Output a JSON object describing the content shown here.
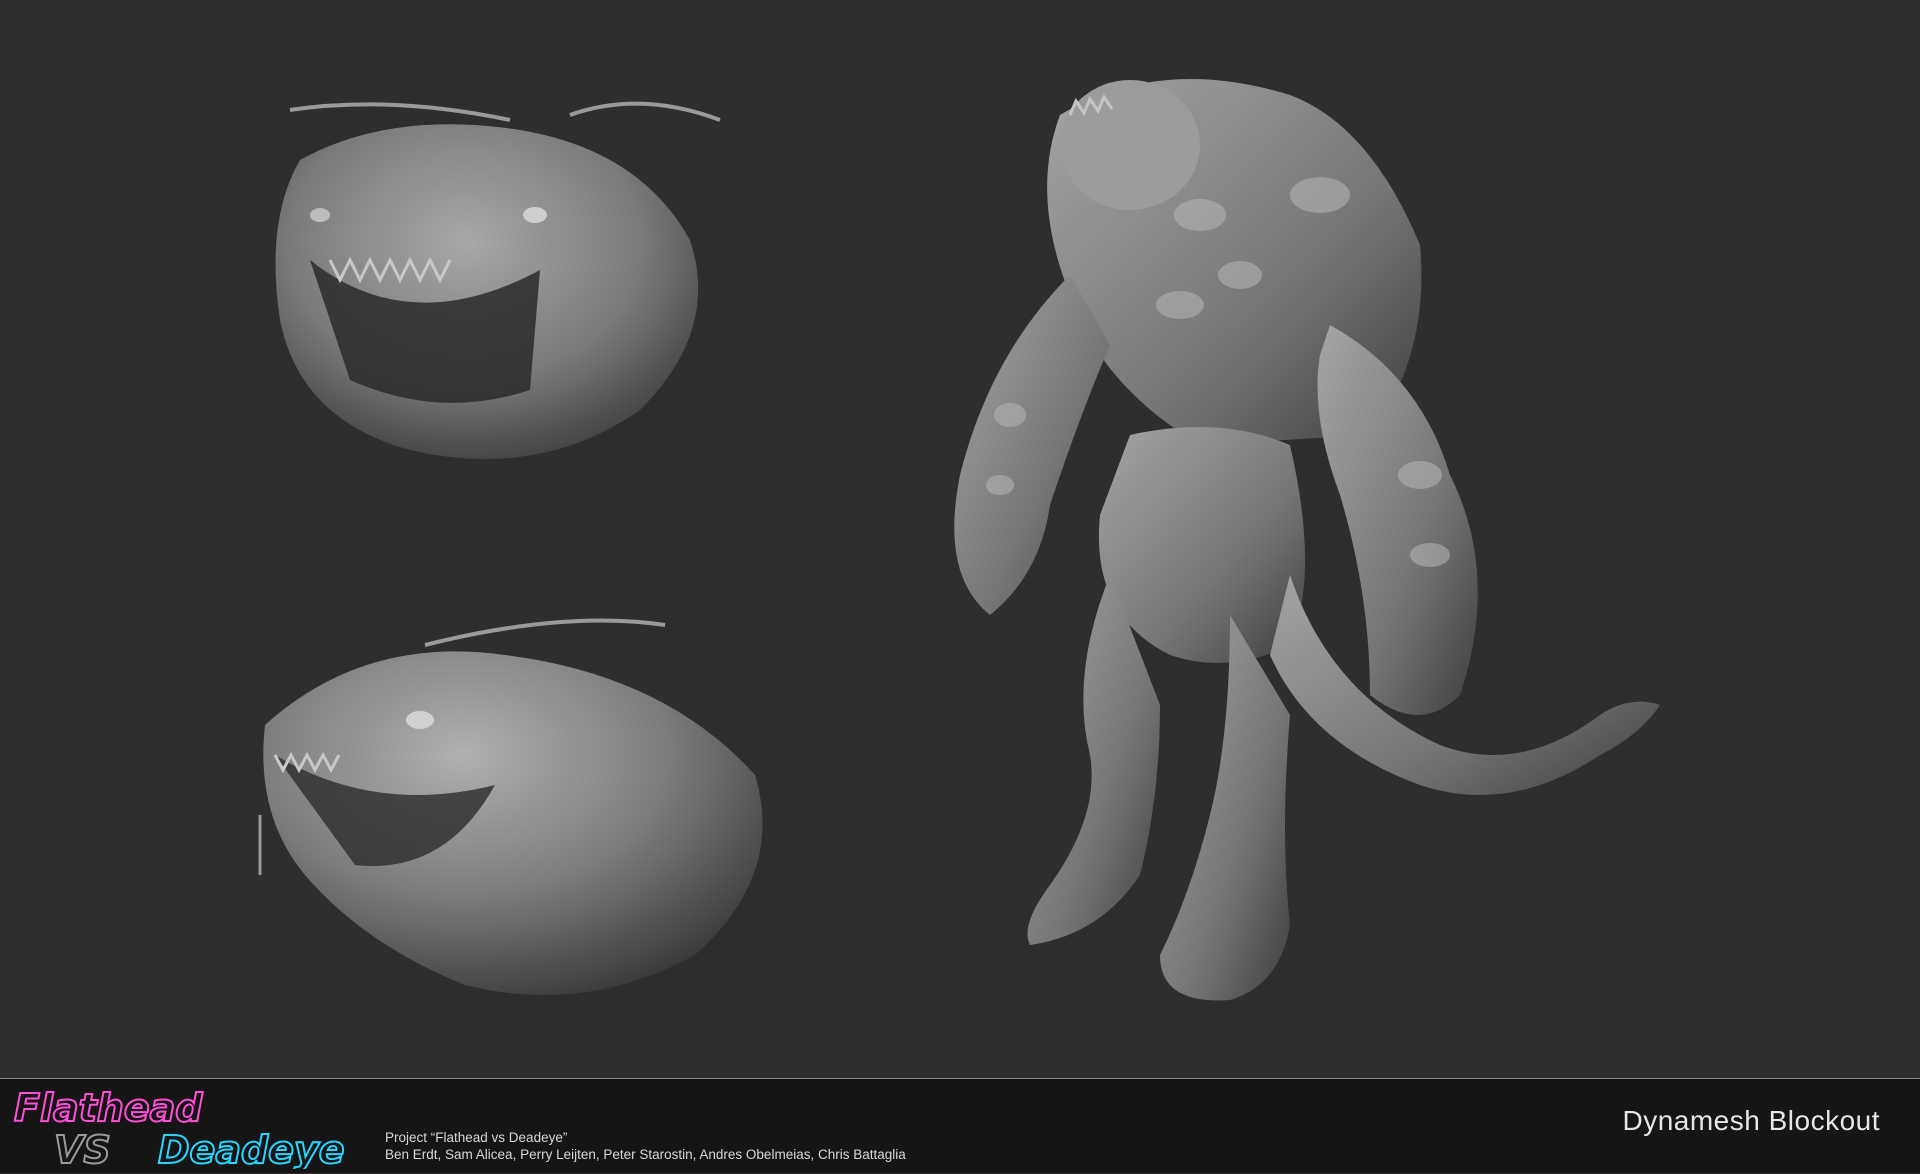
{
  "logo": {
    "word1": "Flathead",
    "word2": "VS",
    "word3": "Deadeye",
    "colors": {
      "flathead": "#ff4fd8",
      "vs": "#9a9a9a",
      "deadeye": "#29d4ff"
    }
  },
  "credits": {
    "project": "Project “Flathead vs Deadeye”",
    "names": "Ben Erdt, Sam Alicea, Perry Leijten, Peter Starostin, Andres Obelmeias, Chris Battaglia"
  },
  "stage_label": "Dynamesh Blockout",
  "renders": [
    {
      "subject": "creature-head-front",
      "icon": "sculpt-head-front"
    },
    {
      "subject": "creature-head-side",
      "icon": "sculpt-head-side"
    },
    {
      "subject": "creature-full-body",
      "icon": "sculpt-full-body"
    }
  ],
  "colors": {
    "background": "#2e2e2e",
    "footer": "#151515",
    "sculpt": "#8d8d8d"
  }
}
